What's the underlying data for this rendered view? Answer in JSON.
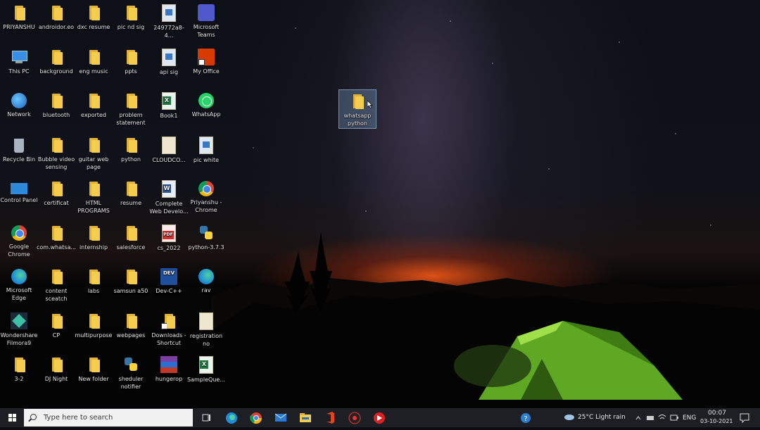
{
  "desktop": {
    "icons": [
      {
        "label": "PRIYANSHU",
        "type": "folder"
      },
      {
        "label": "androidor.eo",
        "type": "folder"
      },
      {
        "label": "dxc resume",
        "type": "folder"
      },
      {
        "label": "pic nd sig",
        "type": "folder"
      },
      {
        "label": "249772a8-4...",
        "type": "image"
      },
      {
        "label": "Microsoft Teams",
        "type": "teams"
      },
      {
        "label": "This PC",
        "type": "pc"
      },
      {
        "label": "background",
        "type": "folder"
      },
      {
        "label": "eng music",
        "type": "folder"
      },
      {
        "label": "ppts",
        "type": "folder"
      },
      {
        "label": "api sig",
        "type": "image"
      },
      {
        "label": "My Office",
        "type": "office"
      },
      {
        "label": "Network",
        "type": "network"
      },
      {
        "label": "bluetooth",
        "type": "folder"
      },
      {
        "label": "exported",
        "type": "folder"
      },
      {
        "label": "problem statement",
        "type": "folder"
      },
      {
        "label": "Book1",
        "type": "excel"
      },
      {
        "label": "WhatsApp",
        "type": "whatsapp"
      },
      {
        "label": "Recycle Bin",
        "type": "recycle"
      },
      {
        "label": "Bubble video sensing",
        "type": "folder"
      },
      {
        "label": "guitar web page",
        "type": "folder"
      },
      {
        "label": "python",
        "type": "folder"
      },
      {
        "label": "CLOUDCO...",
        "type": "file"
      },
      {
        "label": "pic white",
        "type": "image"
      },
      {
        "label": "Control Panel",
        "type": "control"
      },
      {
        "label": "certificat",
        "type": "folder"
      },
      {
        "label": "HTML PROGRAMS",
        "type": "folder"
      },
      {
        "label": "resume",
        "type": "folder"
      },
      {
        "label": "Complete Web Develo...",
        "type": "word"
      },
      {
        "label": "Priyanshu - Chrome",
        "type": "chrome"
      },
      {
        "label": "Google Chrome",
        "type": "chrome"
      },
      {
        "label": "com.whatsa...",
        "type": "folder"
      },
      {
        "label": "internship",
        "type": "folder"
      },
      {
        "label": "salesforce",
        "type": "folder"
      },
      {
        "label": "cs_2022",
        "type": "pdf"
      },
      {
        "label": "python-3.7.3",
        "type": "python"
      },
      {
        "label": "Microsoft Edge",
        "type": "edge"
      },
      {
        "label": "content sceatch",
        "type": "folder"
      },
      {
        "label": "labs",
        "type": "folder"
      },
      {
        "label": "samsun a50",
        "type": "folder"
      },
      {
        "label": "Dev-C++",
        "type": "dev"
      },
      {
        "label": "rav",
        "type": "edge"
      },
      {
        "label": "Wondershare Filmora9",
        "type": "filmora"
      },
      {
        "label": "CP",
        "type": "folder"
      },
      {
        "label": "multipurpose",
        "type": "folder"
      },
      {
        "label": "webpages",
        "type": "folder"
      },
      {
        "label": "Downloads - Shortcut",
        "type": "folder-shortcut"
      },
      {
        "label": "registration no",
        "type": "file"
      },
      {
        "label": "3-2",
        "type": "folder"
      },
      {
        "label": "DJ Night",
        "type": "folder"
      },
      {
        "label": "New folder",
        "type": "folder"
      },
      {
        "label": "sheduler notifier",
        "type": "python"
      },
      {
        "label": "hungerop",
        "type": "winrar"
      },
      {
        "label": "SampleQue...",
        "type": "excel"
      }
    ],
    "selected_icon": {
      "label": "whatsapp python",
      "type": "folder"
    }
  },
  "taskbar": {
    "search_placeholder": "Type here to search",
    "weather": "25°C  Light rain",
    "language": "ENG",
    "time": "00:07",
    "date": "03-10-2021"
  },
  "colors": {
    "taskbar": "#1d1f24",
    "folder": "#f4cd4e",
    "tent": "#6fbf2a"
  }
}
